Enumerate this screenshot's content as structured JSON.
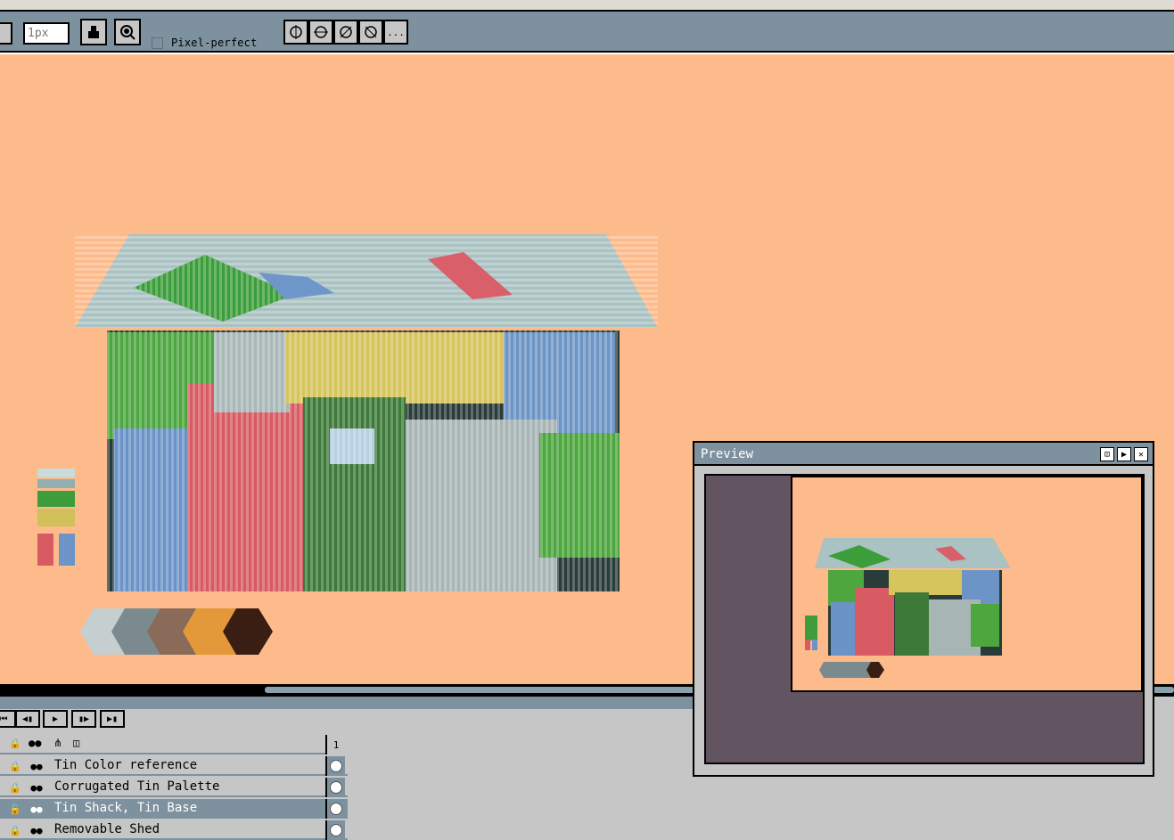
{
  "toolbar": {
    "brush_size_placeholder": "1px",
    "pixel_perfect_label": "Pixel-perfect",
    "more_label": "..."
  },
  "preview": {
    "title": "Preview"
  },
  "timeline": {
    "frame_number": "1",
    "layers": [
      {
        "name": "Tin Color reference",
        "selected": false
      },
      {
        "name": "Corrugated Tin Palette",
        "selected": false
      },
      {
        "name": "Tin Shack, Tin Base",
        "selected": true
      },
      {
        "name": "Removable Shed",
        "selected": false
      }
    ]
  },
  "colors": {
    "canvas_bg": "#fdbb8b",
    "accent": "#7d929e",
    "panel": "#c6c6c6",
    "preview_bg": "#635461"
  }
}
